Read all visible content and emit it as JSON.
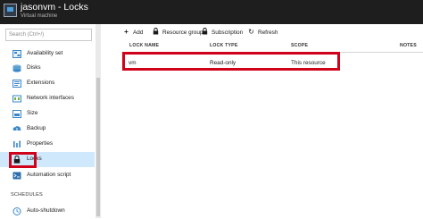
{
  "header": {
    "title": "jasonvm - Locks",
    "subtitle": "Virtual machine"
  },
  "sidebar": {
    "search_placeholder": "Search (Ctrl+/)",
    "items": [
      {
        "label": "Availability set",
        "icon": "availability-set-icon"
      },
      {
        "label": "Disks",
        "icon": "disks-icon"
      },
      {
        "label": "Extensions",
        "icon": "extensions-icon"
      },
      {
        "label": "Network interfaces",
        "icon": "network-interfaces-icon"
      },
      {
        "label": "Size",
        "icon": "size-icon"
      },
      {
        "label": "Backup",
        "icon": "backup-icon"
      },
      {
        "label": "Properties",
        "icon": "properties-icon"
      },
      {
        "label": "Locks",
        "icon": "lock-icon",
        "active": true
      },
      {
        "label": "Automation script",
        "icon": "automation-script-icon"
      }
    ],
    "schedules_section": "SCHEDULES",
    "schedule_items": [
      {
        "label": "Auto-shutdown",
        "icon": "clock-icon"
      }
    ]
  },
  "toolbar": {
    "add_label": "Add",
    "resource_group_label": "Resource group",
    "subscription_label": "Subscription",
    "refresh_label": "Refresh"
  },
  "table": {
    "columns": [
      "LOCK NAME",
      "LOCK TYPE",
      "SCOPE",
      "NOTES"
    ],
    "rows": [
      {
        "lock_name": "vm",
        "lock_type": "Read-only",
        "scope": "This resource",
        "notes": ""
      }
    ]
  },
  "colors": {
    "header_bg": "#1e1e1e",
    "active_item_bg": "#cfe8fb",
    "highlight_border": "#d0021b"
  }
}
